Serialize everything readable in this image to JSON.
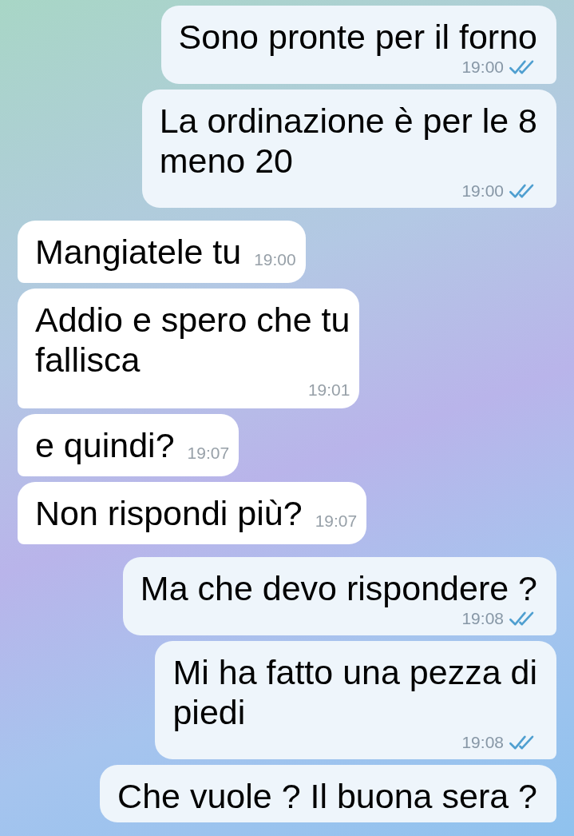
{
  "messages": [
    {
      "kind": "outgoing",
      "text": "Sono pronte per il forno",
      "time": "19:00",
      "read": true
    },
    {
      "kind": "outgoing",
      "text": "La ordinazione è per le 8\nmeno 20",
      "time": "19:00",
      "read": true
    },
    {
      "kind": "incoming",
      "text": "Mangiatele tu",
      "time": "19:00"
    },
    {
      "kind": "incoming",
      "text": "Addio e spero che tu\nfallisca",
      "time": "19:01"
    },
    {
      "kind": "incoming",
      "text": "e quindi?",
      "time": "19:07"
    },
    {
      "kind": "incoming",
      "text": "Non rispondi più?",
      "time": "19:07"
    },
    {
      "kind": "outgoing",
      "text": "Ma che devo rispondere ?",
      "time": "19:08",
      "read": true
    },
    {
      "kind": "outgoing",
      "text": "Mi ha fatto una pezza di\npiedi",
      "time": "19:08",
      "read": true
    },
    {
      "kind": "outgoing",
      "text": "Che vuole ? Il buona sera ?"
    }
  ]
}
